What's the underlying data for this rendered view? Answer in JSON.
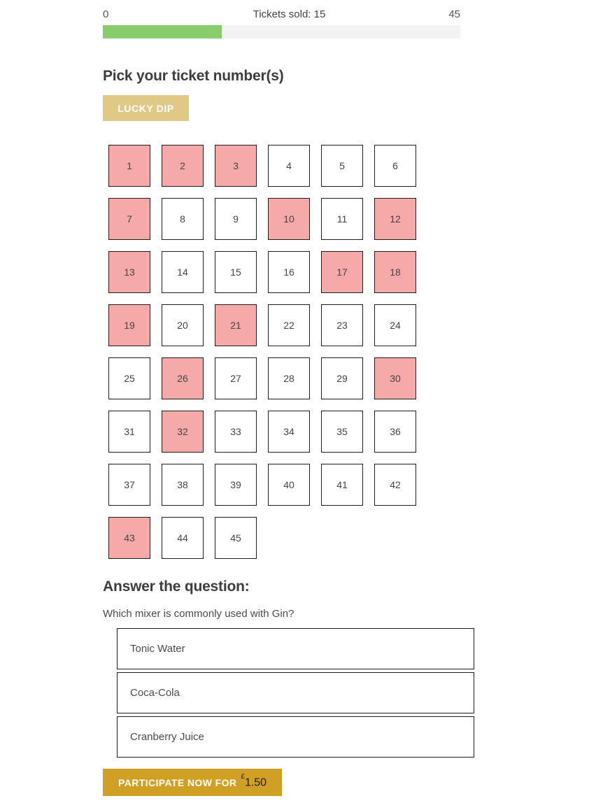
{
  "progress": {
    "min_label": "0",
    "max_label": "45",
    "sold_label": "Tickets sold: 15",
    "sold": 15,
    "total": 45,
    "fill_percent": 33.3,
    "fill_color": "#88cc6c",
    "track_color": "#f3f3f3"
  },
  "pick_section": {
    "title": "Pick your ticket number(s)",
    "lucky_dip_label": "LUCKY DIP",
    "lucky_dip_color": "#e0c887",
    "selected_color": "#f5a9a9",
    "tickets": [
      {
        "number": "1",
        "selected": true
      },
      {
        "number": "2",
        "selected": true
      },
      {
        "number": "3",
        "selected": true
      },
      {
        "number": "4",
        "selected": false
      },
      {
        "number": "5",
        "selected": false
      },
      {
        "number": "6",
        "selected": false
      },
      {
        "number": "7",
        "selected": true
      },
      {
        "number": "8",
        "selected": false
      },
      {
        "number": "9",
        "selected": false
      },
      {
        "number": "10",
        "selected": true
      },
      {
        "number": "11",
        "selected": false
      },
      {
        "number": "12",
        "selected": true
      },
      {
        "number": "13",
        "selected": true
      },
      {
        "number": "14",
        "selected": false
      },
      {
        "number": "15",
        "selected": false
      },
      {
        "number": "16",
        "selected": false
      },
      {
        "number": "17",
        "selected": true
      },
      {
        "number": "18",
        "selected": true
      },
      {
        "number": "19",
        "selected": true
      },
      {
        "number": "20",
        "selected": false
      },
      {
        "number": "21",
        "selected": true
      },
      {
        "number": "22",
        "selected": false
      },
      {
        "number": "23",
        "selected": false
      },
      {
        "number": "24",
        "selected": false
      },
      {
        "number": "25",
        "selected": false
      },
      {
        "number": "26",
        "selected": true
      },
      {
        "number": "27",
        "selected": false
      },
      {
        "number": "28",
        "selected": false
      },
      {
        "number": "29",
        "selected": false
      },
      {
        "number": "30",
        "selected": true
      },
      {
        "number": "31",
        "selected": false
      },
      {
        "number": "32",
        "selected": true
      },
      {
        "number": "33",
        "selected": false
      },
      {
        "number": "34",
        "selected": false
      },
      {
        "number": "35",
        "selected": false
      },
      {
        "number": "36",
        "selected": false
      },
      {
        "number": "37",
        "selected": false
      },
      {
        "number": "38",
        "selected": false
      },
      {
        "number": "39",
        "selected": false
      },
      {
        "number": "40",
        "selected": false
      },
      {
        "number": "41",
        "selected": false
      },
      {
        "number": "42",
        "selected": false
      },
      {
        "number": "43",
        "selected": true
      },
      {
        "number": "44",
        "selected": false
      },
      {
        "number": "45",
        "selected": false
      }
    ]
  },
  "question_section": {
    "title": "Answer the question:",
    "question": "Which mixer is commonly used with Gin?",
    "options": [
      {
        "label": "Tonic Water"
      },
      {
        "label": "Coca-Cola"
      },
      {
        "label": "Cranberry Juice"
      }
    ]
  },
  "participate": {
    "label": "PARTICIPATE NOW FOR",
    "currency": "£",
    "amount": "1.50",
    "color": "#cfa023"
  }
}
